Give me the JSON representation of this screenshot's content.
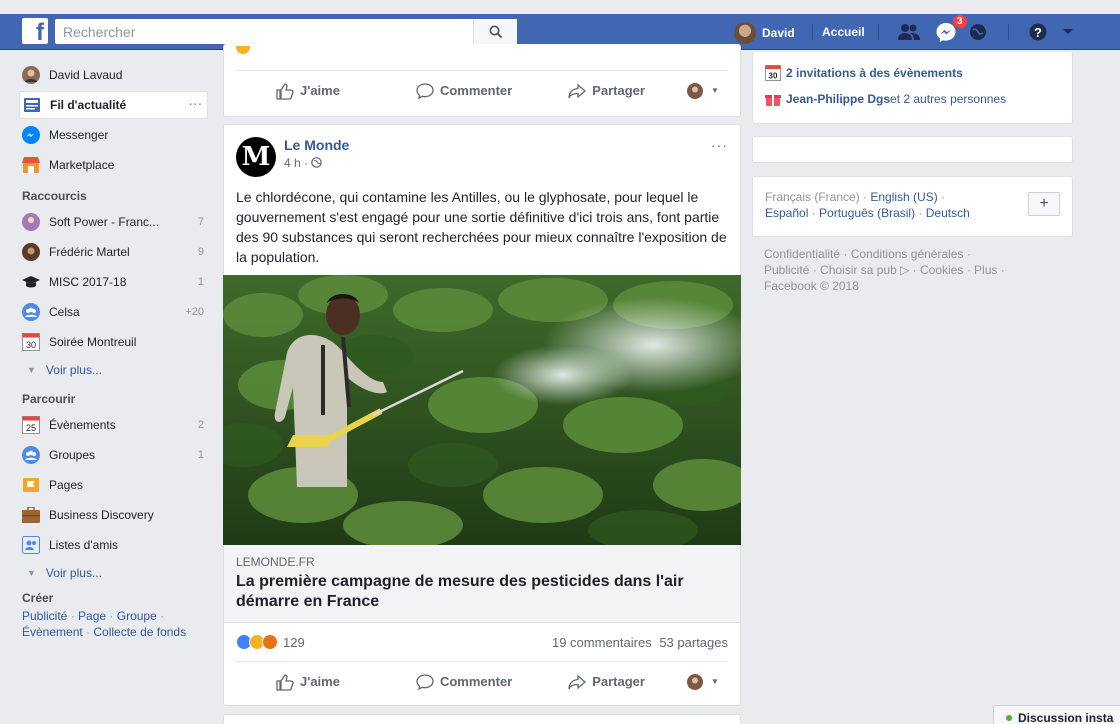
{
  "topbar": {
    "search_placeholder": "Rechercher",
    "user_name": "David",
    "home_label": "Accueil",
    "messages_badge": "3"
  },
  "left": {
    "profile_name": "David Lavaud",
    "main_items": [
      {
        "label": "Fil d'actualité",
        "more": "···"
      },
      {
        "label": "Messenger"
      },
      {
        "label": "Marketplace"
      }
    ],
    "shortcuts_title": "Raccourcis",
    "shortcuts": [
      {
        "label": "Soft Power - Franc...",
        "count": "7"
      },
      {
        "label": "Frédéric Martel",
        "count": "9"
      },
      {
        "label": "MISC 2017-18",
        "count": "1"
      },
      {
        "label": "Celsa",
        "count": "+20"
      },
      {
        "label": "Soirée Montreuil",
        "count": "",
        "date": "30"
      }
    ],
    "see_more": "Voir plus...",
    "browse_title": "Parcourir",
    "browse": [
      {
        "label": "Évènements",
        "count": "2",
        "date": "25"
      },
      {
        "label": "Groupes",
        "count": "1"
      },
      {
        "label": "Pages",
        "count": ""
      },
      {
        "label": "Business Discovery",
        "count": ""
      },
      {
        "label": "Listes d'amis",
        "count": ""
      }
    ],
    "see_more_2": "Voir plus...",
    "create_title": "Créer",
    "create_links": [
      "Publicité",
      "Page",
      "Groupe",
      "Évènement",
      "Collecte de fonds"
    ]
  },
  "feed": {
    "actions": {
      "like": "J'aime",
      "comment": "Commenter",
      "share": "Partager"
    },
    "post": {
      "author": "Le Monde",
      "time": "4 h · ",
      "dots": "···",
      "text": "Le chlordécone, qui contamine les Antilles, ou le glyphosate, pour lequel le gouvernement s'est engagé pour une sortie définitive d'ici trois ans, font partie des 90 substances qui seront recherchées pour mieux connaître l'exposition de la population.",
      "link_domain": "LEMONDE.FR",
      "link_title": "La première campagne de mesure des pesticides dans l'air démarre en France",
      "reactions_count": "129",
      "comments": "19 commentaires",
      "shares": "53 partages"
    }
  },
  "right": {
    "invitations": "2 invitations à des évènements",
    "invitations_date": "30",
    "birthday_name": "Jean-Philippe Dgs",
    "birthday_rest": " et 2 autres personnes",
    "languages": {
      "current": "Français (France)",
      "others": [
        "English (US)",
        "Español",
        "Português (Brasil)",
        "Deutsch"
      ]
    },
    "footer_links": [
      "Confidentialité",
      "Conditions générales",
      "Publicité",
      "Choisir sa pub",
      "Cookies",
      "Plus"
    ],
    "copyright": "Facebook © 2018"
  },
  "chat": {
    "label": "Discussion insta"
  },
  "colors": {
    "brand": "#4267b2",
    "link": "#365899",
    "background": "#e9ebee",
    "badge": "#fa3e3e"
  }
}
